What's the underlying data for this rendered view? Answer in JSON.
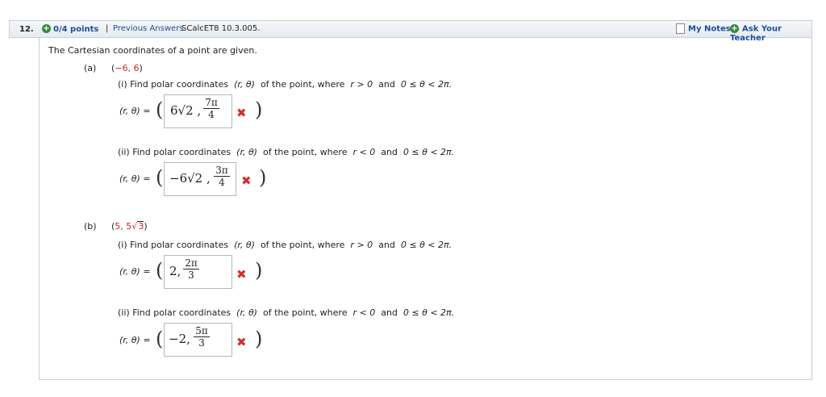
{
  "header": {
    "question_number": "12.",
    "points": "0/4 points",
    "separator": "|",
    "previous_answers": "Previous Answers",
    "source": "SCalcET8 10.3.005.",
    "my_notes": "My Notes",
    "ask_teacher": "Ask Your Teacher"
  },
  "problem": {
    "intro": "The Cartesian coordinates of a point are given.",
    "parts": [
      {
        "label": "(a)",
        "point_open": "(",
        "point_value": "−6, 6",
        "point_close": ")",
        "subparts": [
          {
            "label": "(i) Find polar coordinates",
            "rtheta": "(r, θ)",
            "condition_prefix": "of the point, where",
            "condition_r": "r > 0",
            "and": "and",
            "condition_theta": "0 ≤ θ < 2π.",
            "eq_label": "(r, θ) =",
            "answer_lead": "6√2 ,",
            "answer_num": "7π",
            "answer_den": "4"
          },
          {
            "label": "(ii) Find polar coordinates",
            "rtheta": "(r, θ)",
            "condition_prefix": "of the point, where",
            "condition_r": "r < 0",
            "and": "and",
            "condition_theta": "0 ≤ θ < 2π.",
            "eq_label": "(r, θ) =",
            "answer_lead": "−6√2 ,",
            "answer_num": "3π",
            "answer_den": "4"
          }
        ]
      },
      {
        "label": "(b)",
        "point_open": "(",
        "point_value_a": "5, 5",
        "point_value_sqrt": "3",
        "point_close": ")",
        "subparts": [
          {
            "label": "(i) Find polar coordinates",
            "rtheta": "(r, θ)",
            "condition_prefix": "of the point, where",
            "condition_r": "r > 0",
            "and": "and",
            "condition_theta": "0 ≤ θ < 2π.",
            "eq_label": "(r, θ) =",
            "answer_lead": "2,",
            "answer_num": "2π",
            "answer_den": "3"
          },
          {
            "label": "(ii) Find polar coordinates",
            "rtheta": "(r, θ)",
            "condition_prefix": "of the point, where",
            "condition_r": "r < 0",
            "and": "and",
            "condition_theta": "0 ≤ θ < 2π.",
            "eq_label": "(r, θ) =",
            "answer_lead": "−2,",
            "answer_num": "5π",
            "answer_den": "3"
          }
        ]
      }
    ],
    "open_paren": "(",
    "close_paren": ")",
    "wrong_mark": "✖"
  },
  "colors": {
    "link": "#1a4f9c",
    "wrong": "#d32f2f",
    "given_point": "#c62828"
  }
}
